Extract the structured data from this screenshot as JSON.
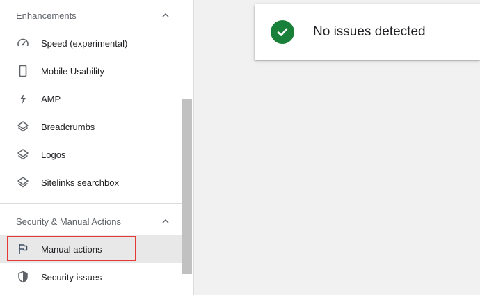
{
  "sidebar": {
    "enhancements": {
      "title": "Enhancements",
      "items": [
        {
          "label": "Speed (experimental)",
          "icon": "speedometer-icon"
        },
        {
          "label": "Mobile Usability",
          "icon": "smartphone-icon"
        },
        {
          "label": "AMP",
          "icon": "lightning-bolt-icon"
        },
        {
          "label": "Breadcrumbs",
          "icon": "layers-icon"
        },
        {
          "label": "Logos",
          "icon": "layers-icon"
        },
        {
          "label": "Sitelinks searchbox",
          "icon": "layers-icon"
        }
      ]
    },
    "security": {
      "title": "Security & Manual Actions",
      "items": [
        {
          "label": "Manual actions",
          "icon": "flag-icon",
          "selected": true
        },
        {
          "label": "Security issues",
          "icon": "shield-icon"
        }
      ]
    }
  },
  "status": {
    "text": "No issues detected",
    "color": "#188038"
  },
  "colors": {
    "highlight": "#e53935",
    "selected_bg": "#e8e8e8"
  }
}
